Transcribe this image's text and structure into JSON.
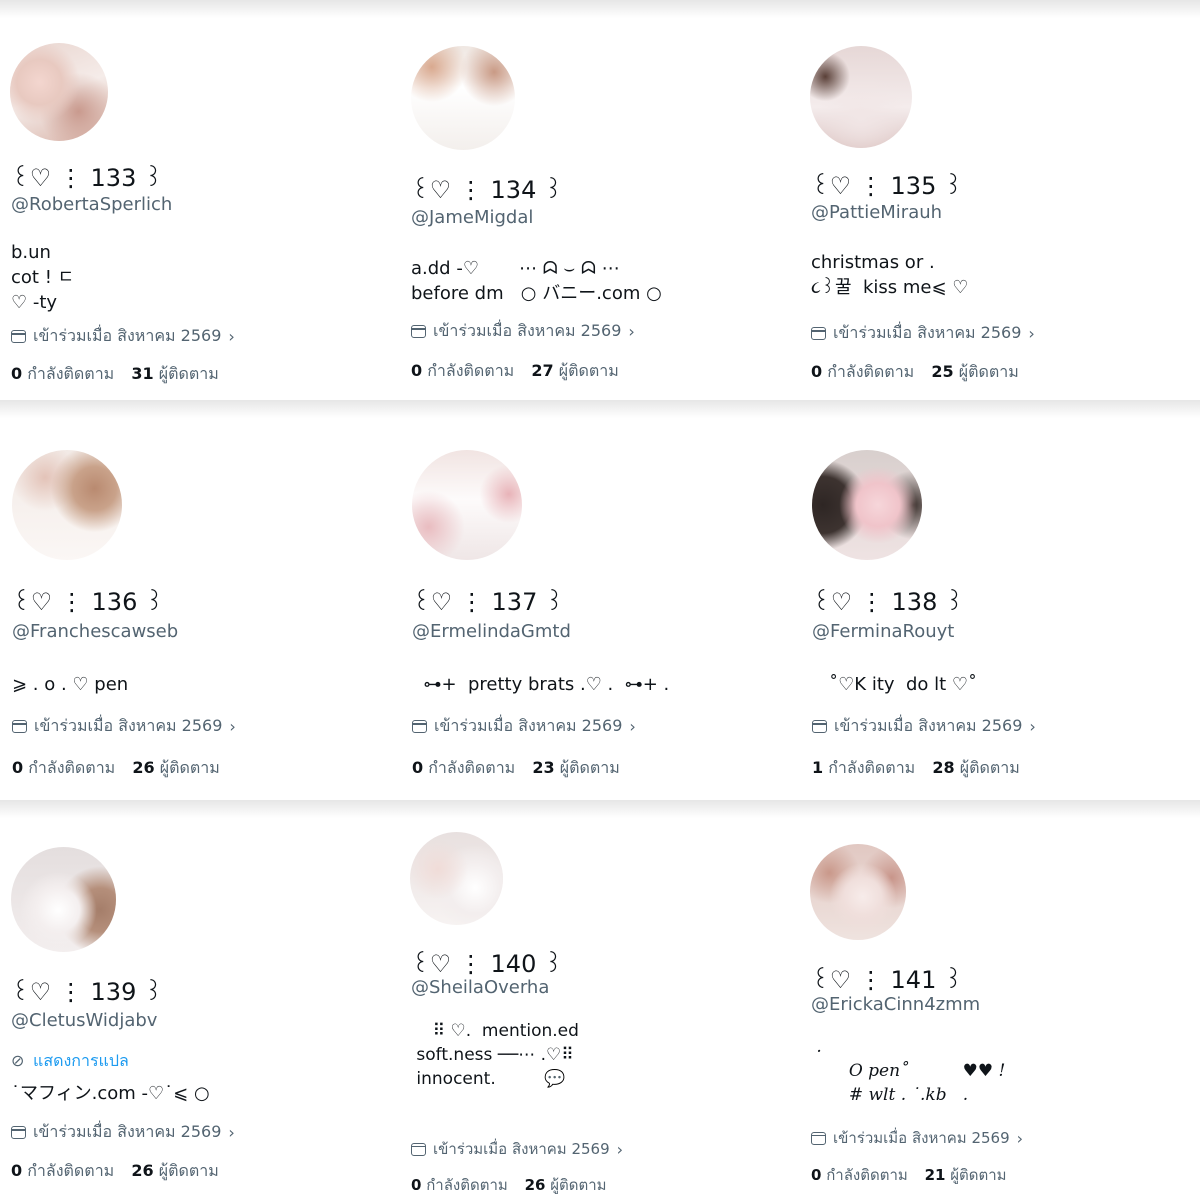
{
  "joined_text": "เข้าร่วมเมื่อ สิงหาคม 2569",
  "following_label": "กำลังติดตาม",
  "followers_label": "ผู้ติดตาม",
  "translate_label": "แสดงการแปล",
  "colors": {
    "text": "#0f1419",
    "muted": "#536471",
    "link": "#1d9bf0"
  },
  "profiles": [
    {
      "avatar_icon": "avatar-photo-floral-top",
      "display_name": "꒰♡ ⋮ 133 ꒱",
      "handle": "@RobertaSperlich",
      "bio": "b.un\ncot ! ㄷ\n♡ -ty",
      "following": "0",
      "followers": "31"
    },
    {
      "avatar_icon": "avatar-photo-white-smock-top",
      "display_name": "꒰♡ ⋮ 134 ꒱",
      "handle": "@JameMigdal",
      "bio": "a.dd -♡       ⋯ ᗣ ⌣ ᗣ ⋯\nbefore dm   ○ バニー.com ○",
      "following": "0",
      "followers": "27"
    },
    {
      "avatar_icon": "avatar-photo-ribbon-blouse",
      "display_name": "꒰♡ ⋮ 135 ꒱",
      "handle": "@PattieMirauh",
      "bio": "christmas or .\n૮꒱꿀  kiss me⩽ ♡",
      "following": "0",
      "followers": "25"
    },
    {
      "avatar_icon": "avatar-photo-epine-shirt",
      "display_name": "꒰♡ ⋮ 136 ꒱",
      "handle": "@Franchescawseb",
      "bio": "⩾ . o . ♡ pen",
      "following": "0",
      "followers": "26"
    },
    {
      "avatar_icon": "avatar-photo-lace-camisole",
      "display_name": "꒰♡ ⋮ 137 ꒱",
      "handle": "@ErmelindaGmtd",
      "bio": "  ⊶+  pretty brats .♡ .  ⊶+ .",
      "following": "0",
      "followers": "23"
    },
    {
      "avatar_icon": "avatar-photo-pink-cardigan-bow",
      "display_name": "꒰♡ ⋮ 138 ꒱",
      "handle": "@FerminaRouyt",
      "bio": "   ˚♡K ity  do lt ♡˚",
      "following": "1",
      "followers": "28"
    },
    {
      "avatar_icon": "avatar-photo-white-bow",
      "display_name": "꒰♡ ⋮ 139 ꒱",
      "handle": "@CletusWidjabv",
      "bio": "˙マフィン.com -♡˙⩽ ○",
      "show_translate": true,
      "following": "0",
      "followers": "26"
    },
    {
      "avatar_icon": "avatar-photo-knit-sleeve",
      "display_name": "꒰♡ ⋮ 140 ꒱",
      "handle": "@SheilaOverha",
      "bio": "    ⠿ ♡.  mention.ed\n soft.ness ──⋯ .♡⠿\n innocent.         💬",
      "following": "0",
      "followers": "26"
    },
    {
      "avatar_icon": "avatar-photo-cream-bow-top",
      "display_name": "꒰♡ ⋮ 141 ꒱",
      "handle": "@ErickaCinn4zmm",
      "bio": " .\n       O pen˚          ♥♥ !\n       # wlt . ˙.kb   .",
      "following": "0",
      "followers": "21"
    }
  ]
}
